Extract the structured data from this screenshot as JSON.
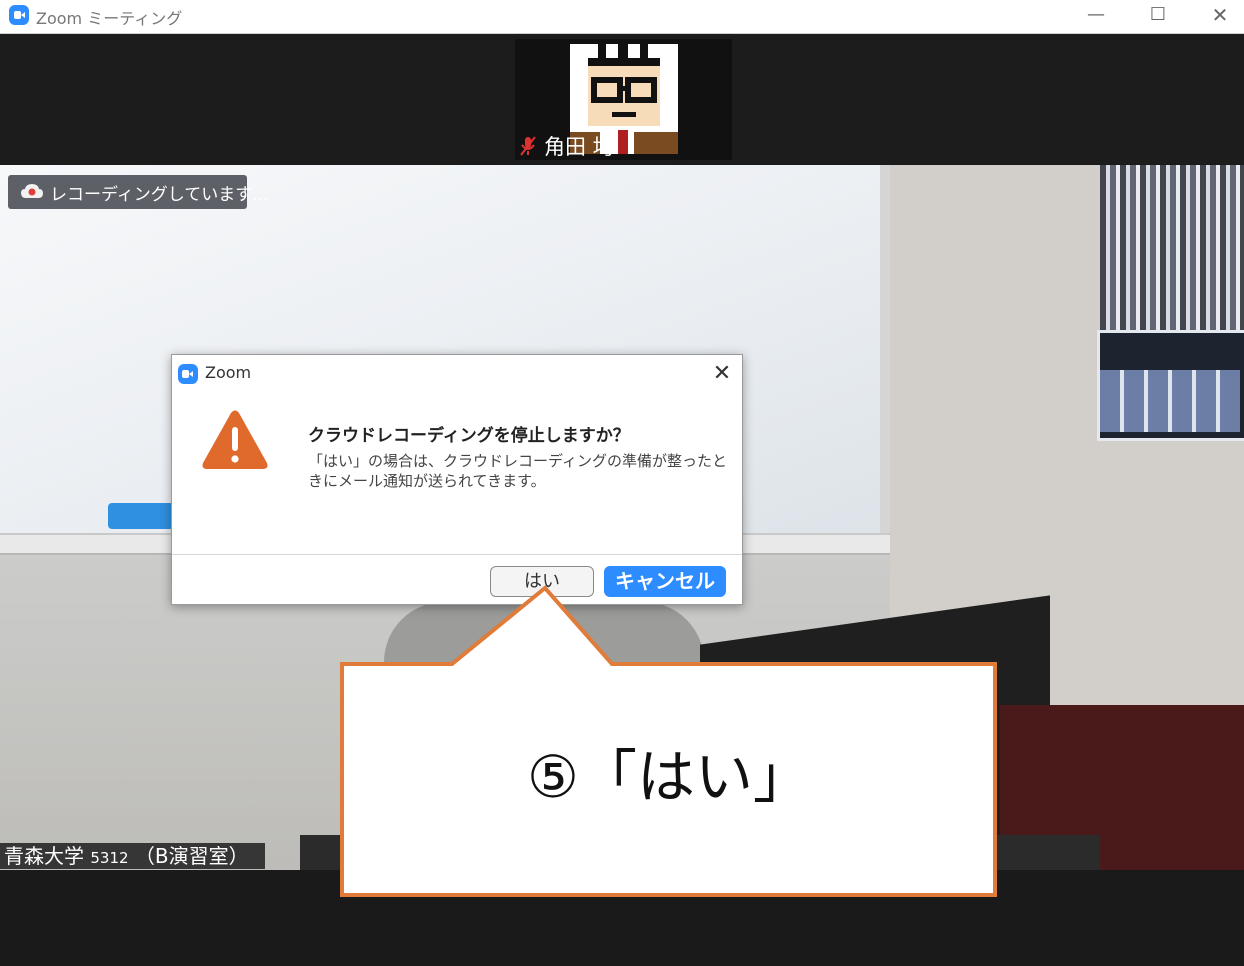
{
  "window": {
    "title": "Zoom ミーティング",
    "minimize_glyph": "—",
    "maximize_glyph": "☐",
    "close_glyph": "✕"
  },
  "participant_thumbnail": {
    "name": "角田 均",
    "mic_state": "muted"
  },
  "recording_badge": {
    "label": "レコーディングしています..."
  },
  "room_label": {
    "name": "青森大学",
    "number": "5312",
    "room": "（B演習室）"
  },
  "dialog": {
    "title": "Zoom",
    "close_glyph": "✕",
    "heading": "クラウドレコーディングを停止しますか？",
    "body": "「はい」の場合は、クラウドレコーディングの準備が整ったときにメール通知が送られてきます。",
    "yes_label": "はい",
    "cancel_label": "キャンセル"
  },
  "callout": {
    "text": "⑤「はい」",
    "border_color": "#E07B39"
  },
  "colors": {
    "zoom_blue": "#2D8CFF",
    "warning_orange": "#E06A2C"
  }
}
